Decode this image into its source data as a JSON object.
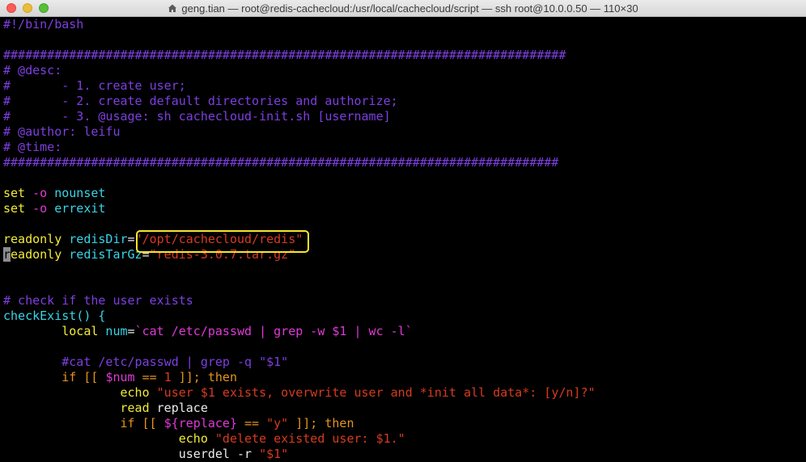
{
  "window": {
    "title": "geng.tian — root@redis-cachecloud:/usr/local/cachecloud/script — ssh root@10.0.0.50 — 110×30"
  },
  "colors": {
    "comment": "#7d3fe0",
    "keyword": "#f3eb3a",
    "identifier": "#39d4e6",
    "string": "#d63b1f",
    "control": "#e6941f",
    "variable": "#e03ad8",
    "highlight_box": "#f7e82b"
  },
  "code": {
    "l1": "#!/bin/bash",
    "l2": "",
    "l3": "#############################################################################",
    "l4": "# @desc:",
    "l5": "#       - 1. create user;",
    "l6": "#       - 2. create default directories and authorize;",
    "l7": "#       - 3. @usage: sh cachecloud-init.sh [username]",
    "l8": "# @author: leifu",
    "l9": "# @time:",
    "l10": "############################################################################",
    "l11": "",
    "l12_set": "set",
    "l12_opt": " -o ",
    "l12_val": "nounset",
    "l13_set": "set",
    "l13_opt": " -o ",
    "l13_val": "errexit",
    "l14": "",
    "l15_kw": "readonly",
    "l15_var": " redisDir",
    "l15_eq": "=",
    "l15_str": "\"/opt/cachecloud/redis\"",
    "l16_cursor": "r",
    "l16_kw": "eadonly",
    "l16_var": " redisTarGz",
    "l16_eq": "=",
    "l16_str": "\"redis-3.0.7.tar.gz\"",
    "l17": "",
    "l18": "",
    "l19": "# check if the user exists",
    "l20_fn": "checkExist",
    "l20_rest": "() {",
    "l21_indent": "        ",
    "l21_kw": "local",
    "l21_var": " num",
    "l21_eq": "=",
    "l21_cmd": "`cat /etc/passwd | grep -w $1 | wc -l`",
    "l22": "",
    "l23_indent": "        ",
    "l23_comment": "#cat /etc/passwd | grep -q \"$1\"",
    "l24_indent": "        ",
    "l24_if": "if",
    "l24_open": " [[ ",
    "l24_var": "$num",
    "l24_op": " == ",
    "l24_num": "1",
    "l24_close": " ]]; ",
    "l24_then": "then",
    "l25_indent": "                ",
    "l25_echo": "echo",
    "l25_str": " \"user $1 exists, overwrite user and *init all data*: [y/n]?\"",
    "l26_indent": "                ",
    "l26_read": "read",
    "l26_var": " replace",
    "l27_indent": "                ",
    "l27_if": "if",
    "l27_open": " [[ ",
    "l27_var": "${replace}",
    "l27_op": " == ",
    "l27_str": "\"y\"",
    "l27_close": " ]]; ",
    "l27_then": "then",
    "l28_indent": "                        ",
    "l28_echo": "echo",
    "l28_str": " \"delete existed user: $1.\"",
    "l29_indent": "                        ",
    "l29_cmd": "userdel -r ",
    "l29_str": "\"$1\""
  }
}
